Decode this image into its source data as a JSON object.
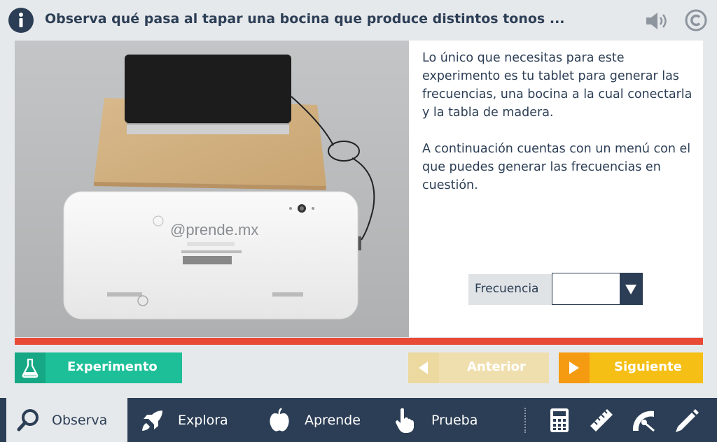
{
  "header": {
    "title": "Observa qué pasa al tapar una bocina que produce distintos tonos ..."
  },
  "photo": {
    "tablet_brand": "@prende.mx"
  },
  "content": {
    "paragraphs": [
      "Lo único que necesitas para este experimento es tu tablet para generar las frecuencias, una bocina a la cual conectarla y la tabla de madera.",
      "A continuación cuentas con un menú con el que puedes generar las frecuencias en cuestión."
    ]
  },
  "frequency": {
    "label": "Frecuencia",
    "value": ""
  },
  "progress": 1.0,
  "buttons": {
    "experiment": "Experimento",
    "previous": "Anterior",
    "next": "Siguiente"
  },
  "nav": {
    "tabs": [
      "Observa",
      "Explora",
      "Aprende",
      "Prueba"
    ],
    "active_tab": "Observa",
    "tools": [
      "calculator-icon",
      "ruler-icon",
      "protractor-icon",
      "pencil-icon"
    ]
  },
  "colors": {
    "navy": "#2c3e55",
    "progress": "#e84a36",
    "experiment": "#1dbf98",
    "next": "#f5bf16",
    "next_icon": "#f59b12",
    "previous_disabled": "#f0dfae"
  }
}
